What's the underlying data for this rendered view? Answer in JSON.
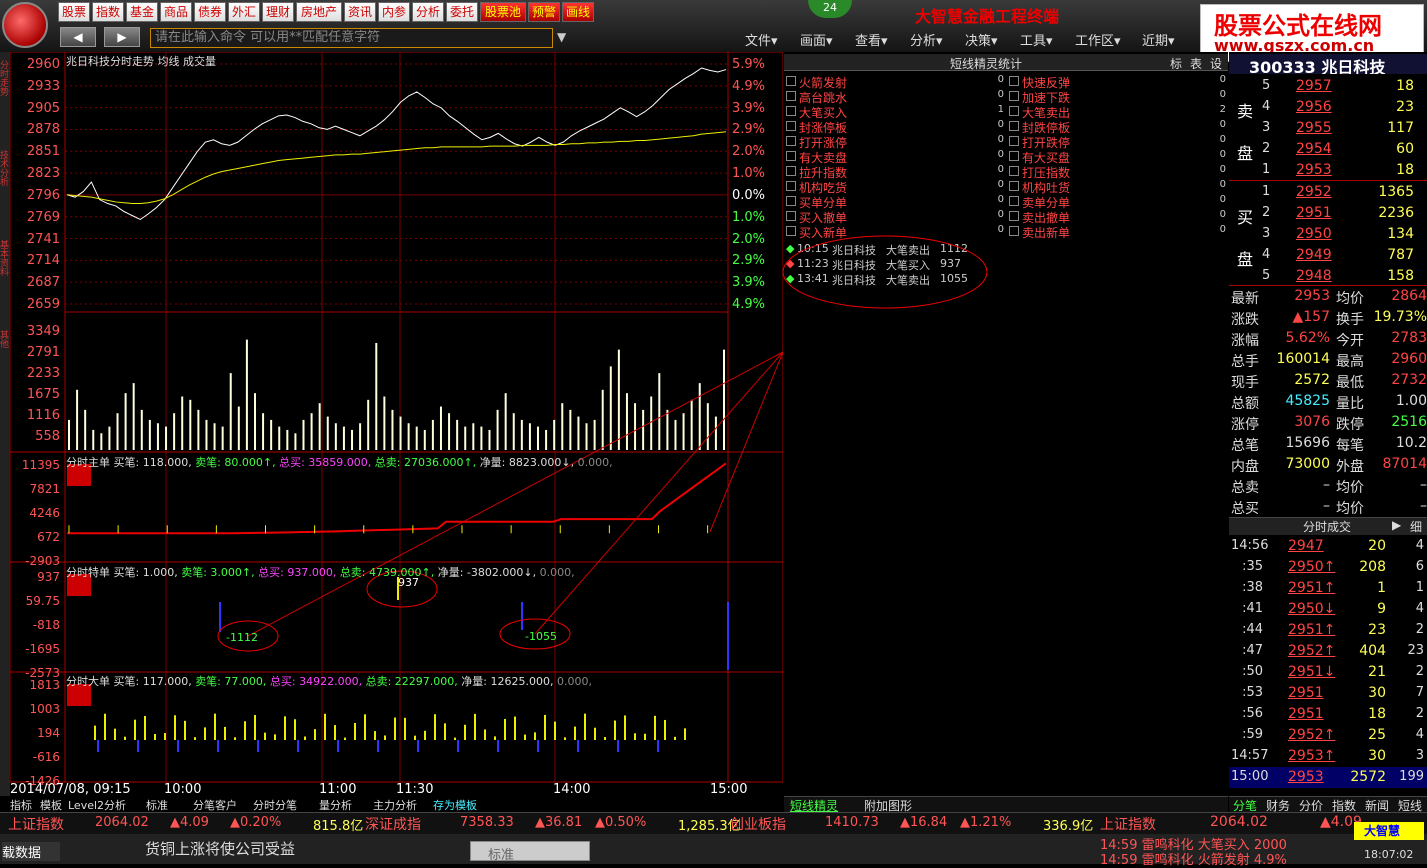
{
  "app": {
    "title": "大智慧金融工程终端",
    "badge": "24",
    "command_placeholder": "请在此输入命令  可以用**匹配任意字符"
  },
  "top_menu": [
    "股票",
    "指数",
    "基金",
    "商品",
    "债券",
    "外汇",
    "理财",
    "房地产",
    "资讯",
    "内参",
    "分析",
    "委托",
    "股票池",
    "预警",
    "画线"
  ],
  "menubar": [
    "文件▾",
    "画面▾",
    "查看▾",
    "分析▾",
    "决策▾",
    "工具▾",
    "工作区▾",
    "近期▾"
  ],
  "watermark": {
    "line1": "股票公式在线网",
    "line2": "www.gszx.com.cn"
  },
  "left_tabs": [
    "分时走势",
    "技术分析",
    "基本资料",
    "其他"
  ],
  "chart_data": [
    {
      "type": "line",
      "title": "兆日科技分时走势 均线 成交量",
      "yticks_price": [
        "2960",
        "2933",
        "2905",
        "2878",
        "2851",
        "2823",
        "2796",
        "2769",
        "2741",
        "2714",
        "2687",
        "2659"
      ],
      "yticks_pct": [
        "5.9%",
        "4.9%",
        "3.9%",
        "2.9%",
        "2.0%",
        "1.0%",
        "0.0%",
        "1.0%",
        "2.0%",
        "2.9%",
        "3.9%",
        "4.9%"
      ],
      "price": [
        2796,
        2793,
        2800,
        2812,
        2790,
        2785,
        2782,
        2775,
        2770,
        2765,
        2772,
        2780,
        2790,
        2805,
        2820,
        2835,
        2850,
        2862,
        2865,
        2860,
        2858,
        2862,
        2870,
        2878,
        2885,
        2890,
        2895,
        2896,
        2893,
        2888,
        2885,
        2880,
        2878,
        2882,
        2878,
        2874,
        2870,
        2876,
        2882,
        2890,
        2900,
        2912,
        2920,
        2925,
        2918,
        2910,
        2905,
        2895,
        2888,
        2880,
        2872,
        2865,
        2868,
        2873,
        2866,
        2860,
        2857,
        2862,
        2868,
        2862,
        2858,
        2862,
        2870,
        2876,
        2881,
        2886,
        2891,
        2898,
        2905,
        2900,
        2894,
        2900,
        2908,
        2918,
        2928,
        2935,
        2942,
        2948,
        2955,
        2952,
        2950,
        2953
      ],
      "avg": [
        2796,
        2795,
        2794,
        2793,
        2791,
        2789,
        2787,
        2786,
        2785,
        2785,
        2786,
        2788,
        2791,
        2796,
        2802,
        2808,
        2813,
        2818,
        2822,
        2825,
        2827,
        2829,
        2831,
        2833,
        2835,
        2837,
        2839,
        2840,
        2841,
        2842,
        2843,
        2844,
        2845,
        2846,
        2846,
        2847,
        2847,
        2848,
        2849,
        2850,
        2851,
        2852,
        2853,
        2854,
        2855,
        2855,
        2856,
        2856,
        2856,
        2856,
        2856,
        2856,
        2857,
        2857,
        2857,
        2857,
        2858,
        2858,
        2858,
        2858,
        2859,
        2859,
        2860,
        2860,
        2861,
        2861,
        2862,
        2862,
        2863,
        2863,
        2864,
        2864,
        2865,
        2866,
        2867,
        2868,
        2869,
        2870,
        2872,
        2873,
        2874,
        2875
      ]
    },
    {
      "type": "bar",
      "title": "成交量",
      "yticks": [
        "3349",
        "2791",
        "2233",
        "1675",
        "1116",
        "558"
      ],
      "values": [
        900,
        1800,
        1200,
        600,
        500,
        700,
        1100,
        1700,
        2000,
        1200,
        900,
        800,
        700,
        1100,
        1600,
        1500,
        1200,
        900,
        800,
        700,
        2300,
        1300,
        3300,
        1700,
        1100,
        900,
        700,
        600,
        500,
        900,
        1100,
        1400,
        1000,
        800,
        700,
        600,
        800,
        1500,
        3200,
        1600,
        1200,
        1000,
        800,
        700,
        600,
        900,
        1300,
        1100,
        900,
        700,
        800,
        700,
        600,
        1200,
        1700,
        1100,
        900,
        800,
        700,
        600,
        900,
        1400,
        1200,
        1000,
        800,
        900,
        1800,
        2500,
        3000,
        1700,
        1400,
        1200,
        1600,
        2300,
        1200,
        900,
        1100,
        1500,
        2000,
        1400,
        1000,
        3000
      ]
    },
    {
      "type": "line",
      "title": "分时主单",
      "yticks": [
        "11395",
        "7821",
        "4246",
        "672",
        "-2903"
      ],
      "labels": {
        "buy_count": "买笔: 118.000,",
        "sell_count": "卖笔: 80.000↑,",
        "total_buy": "总买: 35859.000,",
        "total_sell": "总卖: 27036.000↑,",
        "net": "净量: 8823.000↓,",
        "extra": "0.000,"
      }
    },
    {
      "type": "bar",
      "title": "分时特单",
      "yticks": [
        "937",
        "59.75",
        "-818",
        "-1695",
        "-2573"
      ],
      "labels": {
        "buy_count": "买笔: 1.000,",
        "sell_count": "卖笔: 3.000↑,",
        "total_buy": "总买: 937.000,",
        "total_sell": "总卖: 4739.000↑,",
        "net": "净量: -3802.000↓,",
        "extra": "0.000,"
      },
      "annotations": [
        "-1112",
        "937",
        "-1055"
      ]
    },
    {
      "type": "bar",
      "title": "分时大单",
      "yticks": [
        "1813",
        "1003",
        "194",
        "-616",
        "-1426"
      ],
      "labels": {
        "buy_count": "买笔: 117.000,",
        "sell_count": "卖笔: 77.000,",
        "total_buy": "总买: 34922.000,",
        "total_sell": "总卖: 22297.000,",
        "net": "净量: 12625.000,",
        "extra": "0.000,"
      }
    }
  ],
  "time_axis": {
    "date": "2014/07/08, 09:15",
    "ticks": [
      "10:00",
      "11:00",
      "11:30",
      "14:00",
      "15:00"
    ]
  },
  "bottom_tabs": [
    "指标",
    "模板",
    "Level2分析",
    "标准",
    "分笔客户",
    "分时分笔",
    "量分析",
    "主力分析",
    "存为模板"
  ],
  "sprite": {
    "title": "短线精灵统计",
    "tabs": [
      "标",
      "表",
      "设"
    ],
    "left": [
      {
        "name": "火箭发射",
        "n": "0"
      },
      {
        "name": "高台跳水",
        "n": "0"
      },
      {
        "name": "大笔买入",
        "n": "1"
      },
      {
        "name": "封涨停板",
        "n": "0"
      },
      {
        "name": "打开涨停",
        "n": "0"
      },
      {
        "name": "有大卖盘",
        "n": "0"
      },
      {
        "name": "拉升指数",
        "n": "0"
      },
      {
        "name": "机构吃货",
        "n": "0"
      },
      {
        "name": "买单分单",
        "n": "0"
      },
      {
        "name": "买入撤单",
        "n": "0"
      },
      {
        "name": "买入新单",
        "n": "0"
      }
    ],
    "right": [
      {
        "name": "快速反弹",
        "n": "0"
      },
      {
        "name": "加速下跌",
        "n": "0"
      },
      {
        "name": "大笔卖出",
        "n": "2"
      },
      {
        "name": "封跌停板",
        "n": "0"
      },
      {
        "name": "打开跌停",
        "n": "0"
      },
      {
        "name": "有大买盘",
        "n": "0"
      },
      {
        "name": "打压指数",
        "n": "0"
      },
      {
        "name": "机构吐货",
        "n": "0"
      },
      {
        "name": "卖单分单",
        "n": "0"
      },
      {
        "name": "卖出撤单",
        "n": "0"
      },
      {
        "name": "卖出新单",
        "n": "0"
      }
    ],
    "events": [
      {
        "time": "10:15",
        "stock": "兆日科技",
        "type": "大笔卖出",
        "val": "1112",
        "c": "#44ff44"
      },
      {
        "time": "11:23",
        "stock": "兆日科技",
        "type": "大笔买入",
        "val": "937",
        "c": "#ff4444"
      },
      {
        "time": "13:41",
        "stock": "兆日科技",
        "type": "大笔卖出",
        "val": "1055",
        "c": "#44ff44"
      }
    ],
    "bottom_tabs": [
      "短线精灵",
      "附加图形"
    ]
  },
  "quote": {
    "code": "300333 兆日科技",
    "sell_label": [
      "卖",
      "盘"
    ],
    "buy_label": [
      "买",
      "盘"
    ],
    "sells": [
      [
        "5",
        "2957",
        "18"
      ],
      [
        "4",
        "2956",
        "23"
      ],
      [
        "3",
        "2955",
        "117"
      ],
      [
        "2",
        "2954",
        "60"
      ],
      [
        "1",
        "2953",
        "18"
      ]
    ],
    "buys": [
      [
        "1",
        "2952",
        "1365"
      ],
      [
        "2",
        "2951",
        "2236"
      ],
      [
        "3",
        "2950",
        "134"
      ],
      [
        "4",
        "2949",
        "787"
      ],
      [
        "5",
        "2948",
        "158"
      ]
    ],
    "stats": [
      [
        "最新",
        "2953",
        "均价",
        "2864"
      ],
      [
        "涨跌",
        "▲157",
        "换手",
        "19.73%"
      ],
      [
        "涨幅",
        "5.62%",
        "今开",
        "2783"
      ],
      [
        "总手",
        "160014",
        "最高",
        "2960"
      ],
      [
        "现手",
        "2572",
        "最低",
        "2732"
      ],
      [
        "总额",
        "45825",
        "量比",
        "1.00"
      ],
      [
        "涨停",
        "3076",
        "跌停",
        "2516"
      ],
      [
        "总笔",
        "15696",
        "每笔",
        "10.2"
      ],
      [
        "内盘",
        "73000",
        "外盘",
        "87014"
      ],
      [
        "总卖",
        "–",
        "均价",
        "–"
      ],
      [
        "总买",
        "–",
        "均价",
        "–"
      ]
    ],
    "ticks_title": "分时成交",
    "ticks_more": "细",
    "ticks": [
      [
        "14:56",
        "2947",
        "20",
        "4"
      ],
      [
        ":35",
        "2950↑",
        "208",
        "6"
      ],
      [
        ":38",
        "2951↑",
        "1",
        "1"
      ],
      [
        ":41",
        "2950↓",
        "9",
        "4"
      ],
      [
        ":44",
        "2951↑",
        "23",
        "2"
      ],
      [
        ":47",
        "2952↑",
        "404",
        "23"
      ],
      [
        ":50",
        "2951↓",
        "21",
        "2"
      ],
      [
        ":53",
        "2951",
        "30",
        "7"
      ],
      [
        ":56",
        "2951",
        "18",
        "2"
      ],
      [
        ":59",
        "2952↑",
        "25",
        "4"
      ],
      [
        "14:57",
        "2953↑",
        "30",
        "3"
      ],
      [
        "15:00",
        "2953",
        "2572",
        "199"
      ]
    ],
    "bottom_tabs": [
      "分笔",
      "财务",
      "分价",
      "指数",
      "新闻",
      "短线"
    ]
  },
  "indexbar": [
    {
      "name": "上证指数",
      "v": "2064.02",
      "c": "▲4.09",
      "p": "▲0.20%",
      "a": "815.8亿"
    },
    {
      "name": "深证成指",
      "v": "7358.33",
      "c": "▲36.81",
      "p": "▲0.50%",
      "a": "1,285.3亿"
    },
    {
      "name": "创业板指",
      "v": "1410.73",
      "c": "▲16.84",
      "p": "▲1.21%",
      "a": "336.9亿"
    }
  ],
  "ticker": {
    "name": "上证指数",
    "v": "2064.02",
    "c": "▲4.09",
    "l1": "14:59 雷鸣科化 大笔买入 2000",
    "l2": "14:59 雷鸣科化 火箭发射 4.9%",
    "time": "18:07:02"
  },
  "footer": {
    "news": "货铜上涨将使公司受益",
    "mode": "标准",
    "left": "载数据"
  }
}
